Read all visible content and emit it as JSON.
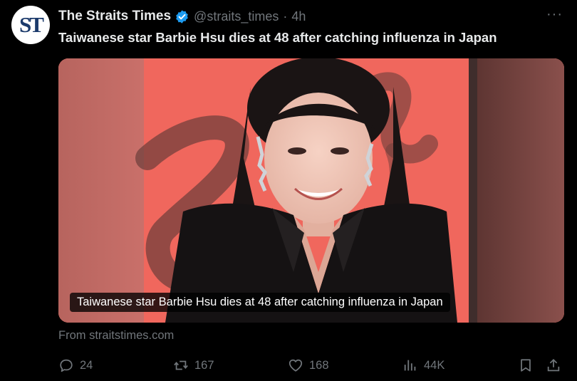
{
  "tweet": {
    "avatar_text": "ST",
    "author_name": "The Straits Times",
    "handle": "@straits_times",
    "separator": "·",
    "time": "4h",
    "more_label": "···",
    "text": "Taiwanese star Barbie Hsu dies at 48 after catching influenza in Japan"
  },
  "card": {
    "caption": "Taiwanese star Barbie Hsu dies at 48 after catching influenza in Japan",
    "source": "From straitstimes.com"
  },
  "actions": {
    "replies": "24",
    "reposts": "167",
    "likes": "168",
    "views": "44K"
  },
  "icons": [
    "verified-badge-icon",
    "more-icon",
    "reply-icon",
    "repost-icon",
    "like-icon",
    "views-icon",
    "bookmark-icon",
    "share-icon"
  ],
  "colors": {
    "background": "#000000",
    "text_primary": "#e7e9ea",
    "text_secondary": "#71767b",
    "verified": "#1d9bf0",
    "photo_backdrop": "#f0675d"
  }
}
